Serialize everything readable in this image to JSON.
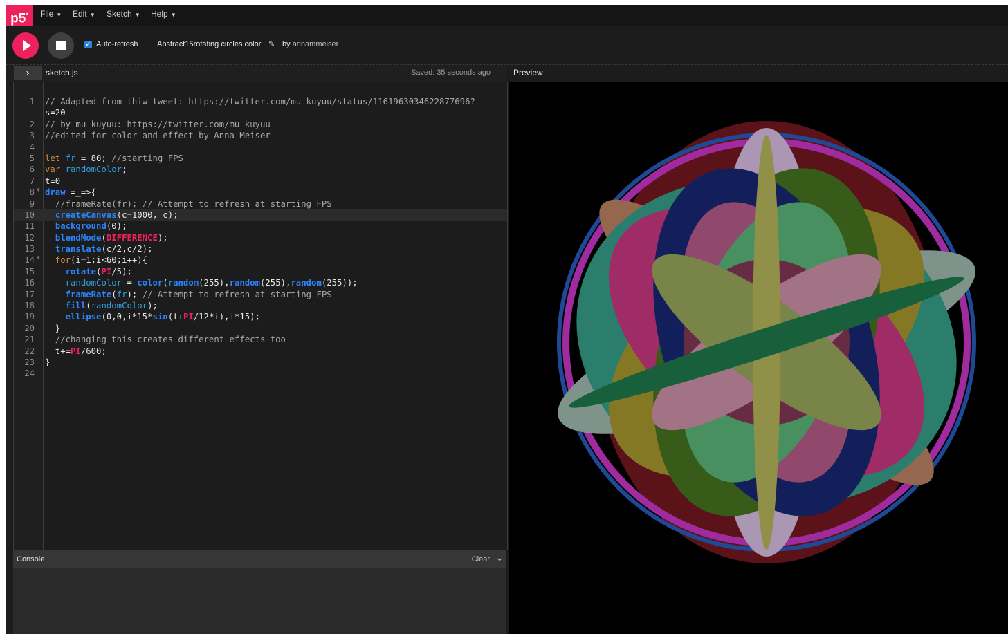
{
  "menu": {
    "logo": "p5",
    "logo_sup": "*",
    "items": [
      "File",
      "Edit",
      "Sketch",
      "Help"
    ]
  },
  "toolbar": {
    "autorefresh_label": "Auto-refresh",
    "autorefresh_checked": true,
    "sketch_name": "Abstract15rotating circles color",
    "by_label": "by",
    "author": "annammeiser"
  },
  "editor": {
    "file_tab": "sketch.js",
    "saved_status": "Saved: 35 seconds ago",
    "preview_label": "Preview",
    "active_line": 10,
    "lines": [
      {
        "n": "1",
        "text": "// Adapted from thiw tweet: https://twitter.com/mu_kuyuu/status/1161963034622877696?"
      },
      {
        "n": "",
        "text": "s=20"
      },
      {
        "n": "2",
        "text": "// by mu_kuyuu: https://twitter.com/mu_kuyuu"
      },
      {
        "n": "3",
        "text": "//edited for color and effect by Anna Meiser"
      },
      {
        "n": "4",
        "text": ""
      },
      {
        "n": "5",
        "text": "let fr = 80; //starting FPS"
      },
      {
        "n": "6",
        "text": "var randomColor;"
      },
      {
        "n": "7",
        "text": "t=0"
      },
      {
        "n": "8",
        "text": "draw =_=>{"
      },
      {
        "n": "9",
        "text": "  //frameRate(fr); // Attempt to refresh at starting FPS"
      },
      {
        "n": "10",
        "text": "  createCanvas(c=1000, c);"
      },
      {
        "n": "11",
        "text": "  background(0);"
      },
      {
        "n": "12",
        "text": "  blendMode(DIFFERENCE);"
      },
      {
        "n": "13",
        "text": "  translate(c/2,c/2);"
      },
      {
        "n": "14",
        "text": "  for(i=1;i<60;i++){"
      },
      {
        "n": "15",
        "text": "    rotate(PI/5);"
      },
      {
        "n": "16",
        "text": "    randomColor = color(random(255),random(255),random(255));"
      },
      {
        "n": "17",
        "text": "    frameRate(fr); // Attempt to refresh at starting FPS"
      },
      {
        "n": "18",
        "text": "    fill(randomColor);"
      },
      {
        "n": "19",
        "text": "    ellipse(0,0,i*15*sin(t+PI/12*i),i*15);"
      },
      {
        "n": "20",
        "text": "  }"
      },
      {
        "n": "21",
        "text": "  //changing this creates different effects too"
      },
      {
        "n": "22",
        "text": "  t+=PI/600;"
      },
      {
        "n": "23",
        "text": "}"
      },
      {
        "n": "24",
        "text": ""
      }
    ]
  },
  "console": {
    "title": "Console",
    "clear_label": "Clear"
  },
  "colors": {
    "accent": "#ed225d",
    "background": "#1c1c1c",
    "preview_bg": "#000000"
  }
}
